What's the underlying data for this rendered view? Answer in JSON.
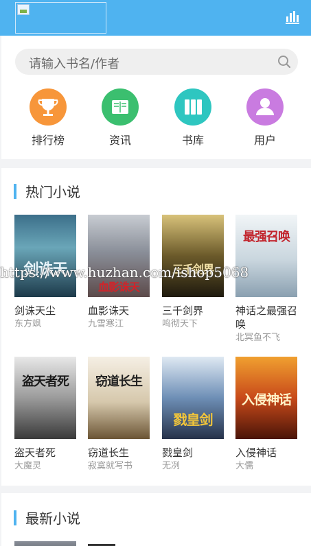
{
  "header": {
    "logo_icon": "broken-image-icon",
    "menu_icon": "bar-chart-icon"
  },
  "search": {
    "placeholder": "请输入书名/作者",
    "icon": "search-icon"
  },
  "nav": [
    {
      "label": "排行榜",
      "icon": "trophy-icon",
      "color": "#f7963a"
    },
    {
      "label": "资讯",
      "icon": "book-icon",
      "color": "#3bbf6f"
    },
    {
      "label": "书库",
      "icon": "library-icon",
      "color": "#2ec6c0"
    },
    {
      "label": "用户",
      "icon": "user-icon",
      "color": "#c97be0"
    }
  ],
  "hot": {
    "title": "热门小说",
    "books": [
      {
        "name": "剑诛天尘",
        "author": "东方飒",
        "cover_text": "剑诛天"
      },
      {
        "name": "血影诛天",
        "author": "九雪寒江",
        "cover_text": "血影诛天"
      },
      {
        "name": "三千剑界",
        "author": "鸣彻天下",
        "cover_text": "三千剑界"
      },
      {
        "name": "神话之最强召唤",
        "author": "北冥鱼不飞",
        "cover_text": "最强召唤"
      },
      {
        "name": "盗天者死",
        "author": "大魔灵",
        "cover_text": "盗天者死"
      },
      {
        "name": "窃道长生",
        "author": "寂寞就写书",
        "cover_text": "窃道长生"
      },
      {
        "name": "戮皇剑",
        "author": "无冽",
        "cover_text": "戮皇剑"
      },
      {
        "name": "入侵神话",
        "author": "大儒",
        "cover_text": "入侵神话"
      }
    ]
  },
  "latest": {
    "title": "最新小说"
  },
  "watermark": "https://www.huzhan.com/ishop5068",
  "colors": {
    "accent": "#4fb3f0"
  }
}
